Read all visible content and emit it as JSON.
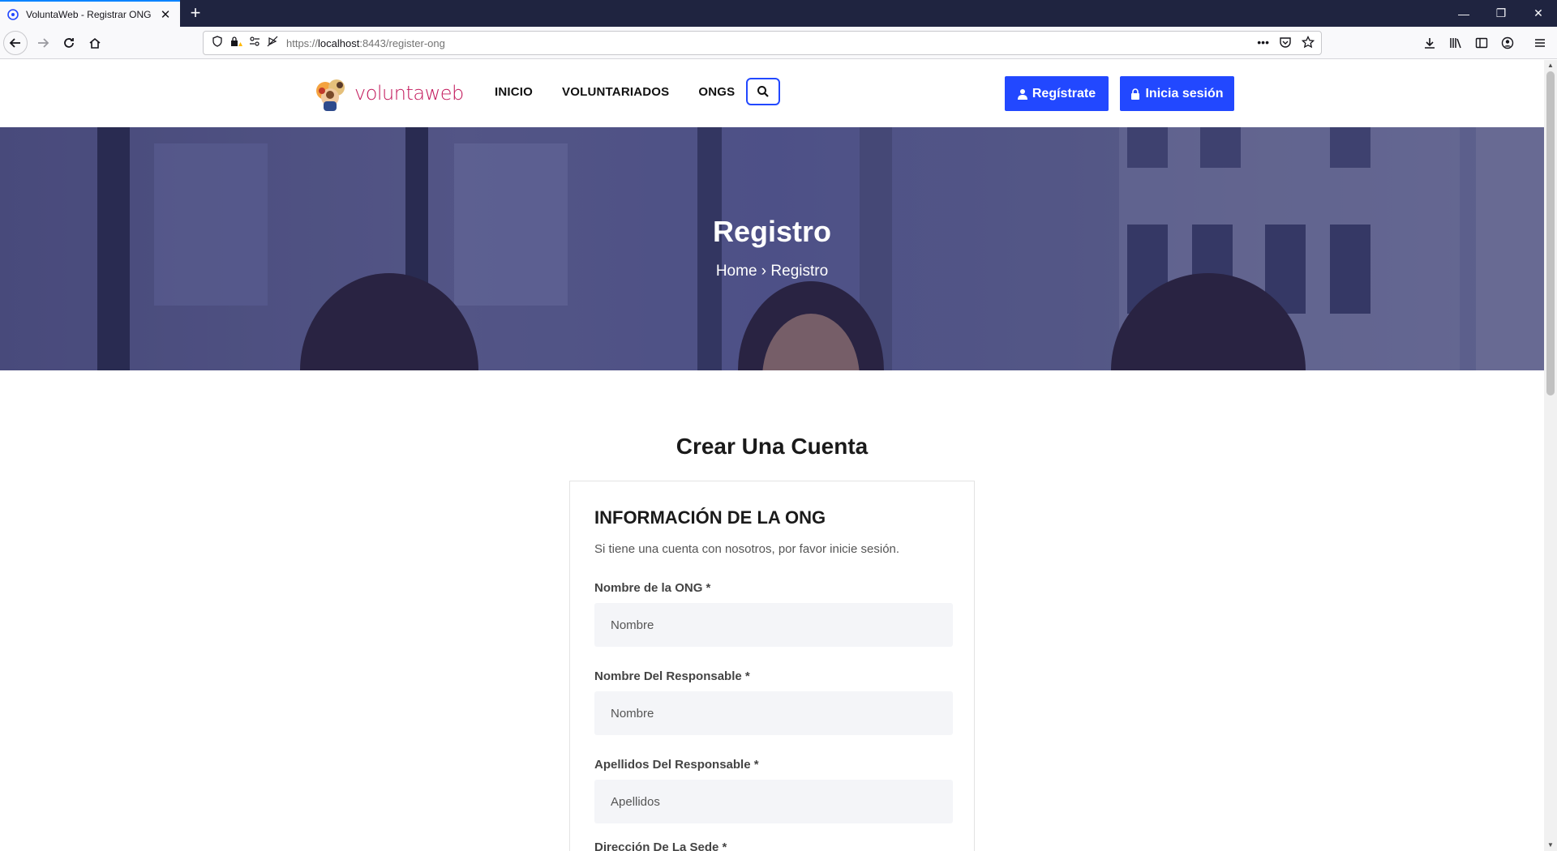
{
  "browser": {
    "tab_title": "VoluntaWeb - Registrar ONG",
    "url_prefix": "https://",
    "url_host": "localhost",
    "url_rest": ":8443/register-ong"
  },
  "header": {
    "logo_text": "voluntaweb",
    "menu": [
      {
        "label": "INICIO"
      },
      {
        "label": "VOLUNTARIADOS"
      },
      {
        "label": "ONGS"
      }
    ],
    "register_label": "Regístrate",
    "login_label": "Inicia sesión"
  },
  "hero": {
    "title": "Registro",
    "breadcrumb_home": "Home",
    "breadcrumb_sep": "›",
    "breadcrumb_current": "Registro"
  },
  "form": {
    "section_title": "Crear Una Cuenta",
    "card_title": "INFORMACIÓN DE LA ONG",
    "card_subtitle": "Si tiene una cuenta con nosotros, por favor inicie sesión.",
    "fields": [
      {
        "label": "Nombre de la ONG *",
        "placeholder": "Nombre"
      },
      {
        "label": "Nombre Del Responsable *",
        "placeholder": "Nombre"
      },
      {
        "label": "Apellidos Del Responsable *",
        "placeholder": "Apellidos"
      },
      {
        "label": "Dirección De La Sede *",
        "placeholder": ""
      }
    ]
  },
  "colors": {
    "accent": "#2248ff",
    "logo": "#c2185b",
    "chrome_dark": "#1f2440"
  }
}
